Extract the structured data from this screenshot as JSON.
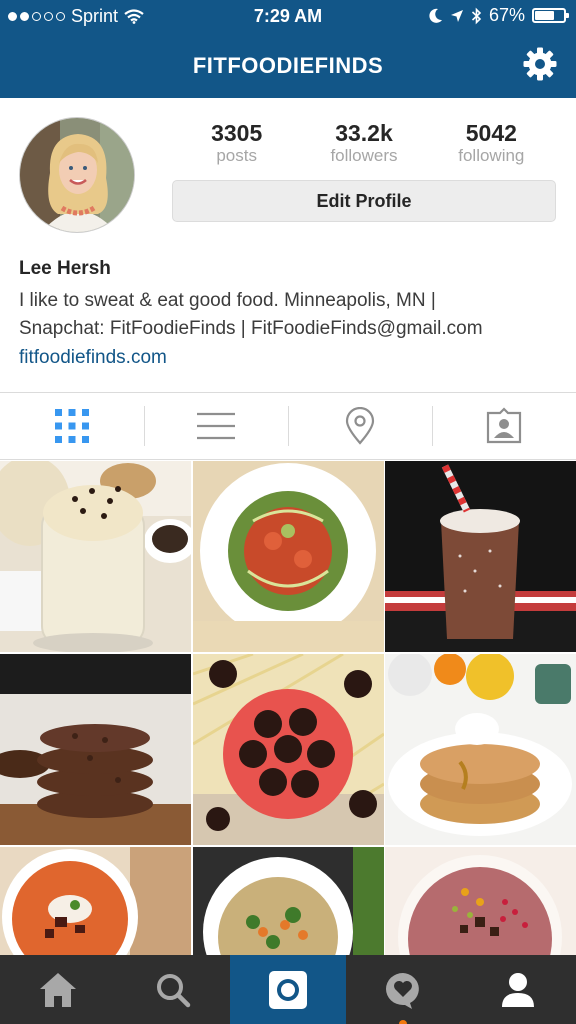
{
  "status_bar": {
    "carrier": "Sprint",
    "time": "7:29 AM",
    "battery": "67%",
    "battery_level": 0.67,
    "signal_bars": 2
  },
  "header": {
    "title": "FITFOODIEFINDS",
    "settings_icon": "gear-icon"
  },
  "profile": {
    "stats": [
      {
        "value": "3305",
        "label": "posts"
      },
      {
        "value": "33.2k",
        "label": "followers"
      },
      {
        "value": "5042",
        "label": "following"
      }
    ],
    "edit_button": "Edit Profile",
    "name": "Lee Hersh",
    "bio_lines": [
      "I like to sweat & eat good food. Minneapolis, MN |",
      "Snapchat: FitFoodieFinds | FitFoodieFinds@gmail.com"
    ],
    "website": "fitfoodiefinds.com"
  },
  "view_tabs": [
    {
      "icon": "grid-icon",
      "active": true
    },
    {
      "icon": "list-icon",
      "active": false
    },
    {
      "icon": "location-pin-icon",
      "active": false
    },
    {
      "icon": "tagged-photos-icon",
      "active": false
    }
  ],
  "bottom_nav": [
    {
      "icon": "home-icon",
      "active": false
    },
    {
      "icon": "search-icon",
      "active": false
    },
    {
      "icon": "camera-icon",
      "active": true
    },
    {
      "icon": "activity-heart-icon",
      "active": false
    },
    {
      "icon": "profile-icon",
      "active": false
    }
  ],
  "colors": {
    "brand_blue": "#125688",
    "nav_dark": "#2f2f2f",
    "link_blue": "#125688",
    "notification_orange": "#f3780d"
  }
}
